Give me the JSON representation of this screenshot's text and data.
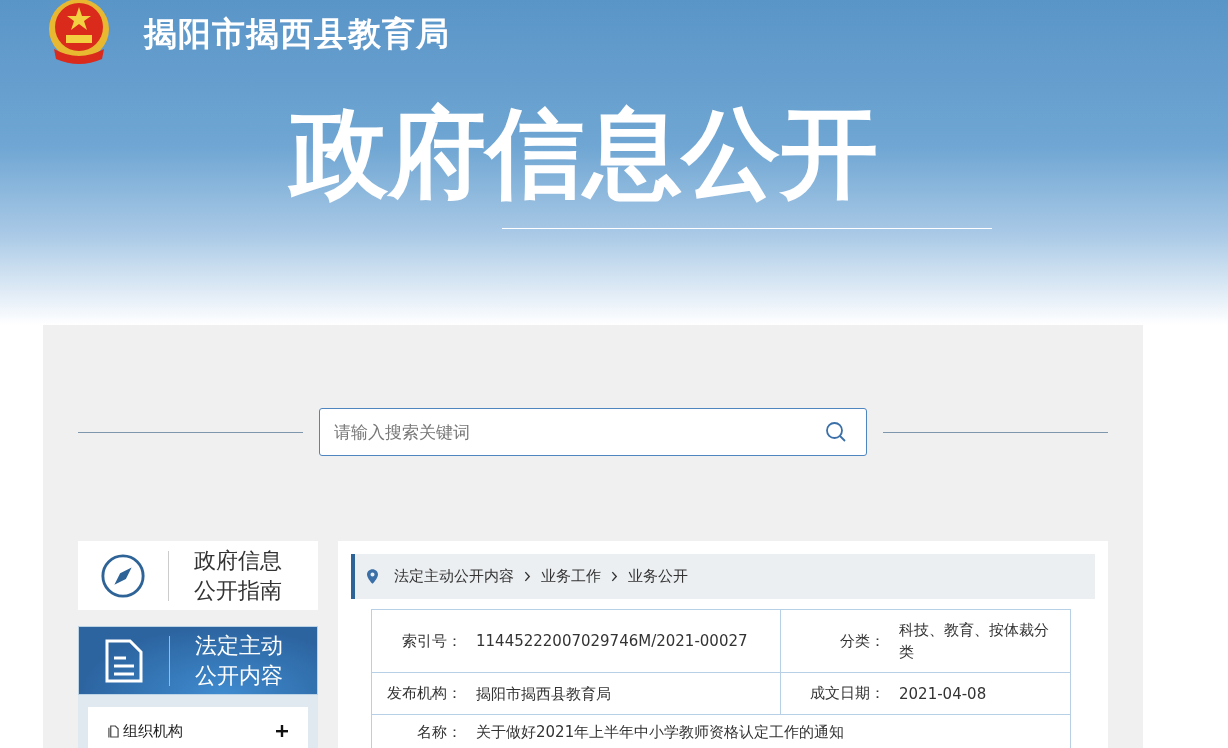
{
  "header": {
    "site_title": "揭阳市揭西县教育局",
    "banner_title": "政府信息公开"
  },
  "search": {
    "placeholder": "请输入搜索关键词"
  },
  "sidebar": {
    "items": [
      {
        "label": "政府信息公开指南",
        "kind": "guide",
        "selected": false
      },
      {
        "label": "法定主动公开内容",
        "kind": "document",
        "selected": true
      }
    ],
    "subitems": [
      {
        "label": "组织机构",
        "expanded": false
      }
    ]
  },
  "breadcrumb": [
    "法定主动公开内容",
    "业务工作",
    "业务公开"
  ],
  "details": [
    [
      {
        "label": "索引号：",
        "value": "11445222007029746M/2021-00027"
      },
      {
        "label": "分类：",
        "value": "科技、教育、按体裁分类"
      }
    ],
    [
      {
        "label": "发布机构：",
        "value": "揭阳市揭西县教育局"
      },
      {
        "label": "成文日期：",
        "value": "2021-04-08"
      }
    ],
    [
      {
        "label": "名称：",
        "value": "关于做好2021年上半年中小学教师资格认定工作的通知"
      }
    ]
  ]
}
